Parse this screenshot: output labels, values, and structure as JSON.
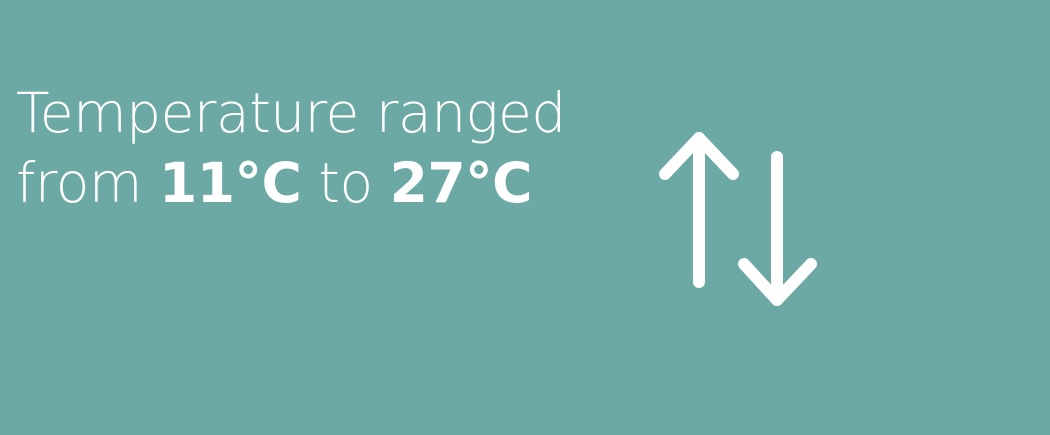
{
  "headline": {
    "line1": "Temperature ranged",
    "from_word": "from",
    "min_value": "11°C",
    "to_word": "to",
    "max_value": "27°C"
  },
  "icons": {
    "arrows": "up-down-arrows-icon"
  },
  "colors": {
    "background": "#6ca9a5",
    "foreground": "#ffffff"
  }
}
